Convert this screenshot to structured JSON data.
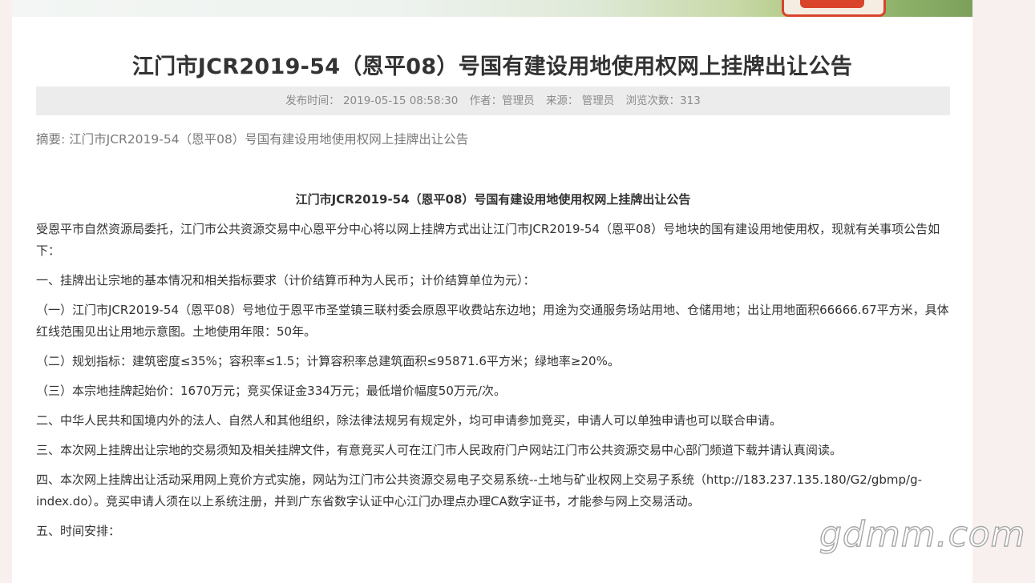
{
  "article": {
    "title": "江门市JCR2019-54（恩平08）号国有建设用地使用权网上挂牌出让公告",
    "meta": {
      "publish_time": "发布时间：  2019-05-15 08:58:30",
      "author": "作者：管理员",
      "source": "来源：  管理员",
      "views": "浏览次数：313"
    },
    "summary": "摘要: 江门市JCR2019-54（恩平08）号国有建设用地使用权网上挂牌出让公告",
    "content_title": "江门市JCR2019-54（恩平08）号国有建设用地使用权网上挂牌出让公告",
    "paragraphs": [
      "受恩平市自然资源局委托，江门市公共资源交易中心恩平分中心将以网上挂牌方式出让江门市JCR2019-54（恩平08）号地块的国有建设用地使用权，现就有关事项公告如下：",
      "一、挂牌出让宗地的基本情况和相关指标要求（计价结算币种为人民币；计价结算单位为元）：",
      "（一）江门市JCR2019-54（恩平08）号地位于恩平市圣堂镇三联村委会原恩平收费站东边地；用途为交通服务场站用地、仓储用地；出让用地面积66666.67平方米，具体红线范围见出让用地示意图。土地使用年限：50年。",
      "（二）规划指标：建筑密度≤35%；容积率≤1.5；计算容积率总建筑面积≤95871.6平方米；绿地率≥20%。",
      "（三）本宗地挂牌起始价：1670万元；竞买保证金334万元；最低增价幅度50万元/次。",
      "二、中华人民共和国境内外的法人、自然人和其他组织，除法律法规另有规定外，均可申请参加竞买，申请人可以单独申请也可以联合申请。",
      "三、本次网上挂牌出让宗地的交易须知及相关挂牌文件，有意竞买人可在江门市人民政府门户网站江门市公共资源交易中心部门频道下载并请认真阅读。",
      "四、本次网上挂牌出让活动采用网上竞价方式实施，网站为江门市公共资源交易电子交易系统--土地与矿业权网上交易子系统（http://183.237.135.180/G2/gbmp/g-index.do）。竞买申请人须在以上系统注册，并到广东省数字认证中心江门办理点办理CA数字证书，才能参与网上交易活动。",
      "五、时间安排："
    ]
  },
  "watermark": "gdmm.com"
}
